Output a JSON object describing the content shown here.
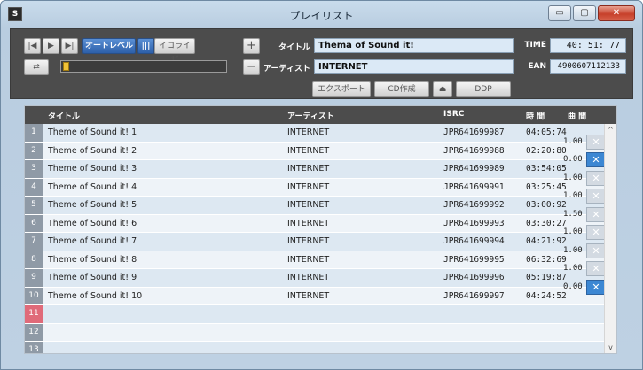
{
  "window": {
    "title": "プレイリスト",
    "minimize": "▭",
    "maximize": "▢",
    "close": "✕"
  },
  "toolbar": {
    "prev": "|◀",
    "play": "▶",
    "next": "▶|",
    "auto_level": "オートレベル",
    "eq_icon": "|||",
    "equalizer": "イコライザ",
    "repeat": "⇄",
    "add": "+",
    "remove": "−",
    "export": "エクスポート",
    "cd_create": "CD作成",
    "eject": "⏏",
    "ddp": "DDP"
  },
  "meta": {
    "title_label": "タイトル",
    "title_value": "Thema of Sound it!",
    "artist_label": "アーティスト",
    "artist_value": "INTERNET",
    "time_label": "TIME",
    "time_value": "40: 51: 77",
    "ean_label": "EAN",
    "ean_value": "4900607112133"
  },
  "columns": [
    "タイトル",
    "アーティスト",
    "ISRC",
    "時 間",
    "曲 間"
  ],
  "rows": [
    {
      "num": "1",
      "title": "Theme of Sound it! 1",
      "artist": "INTERNET",
      "isrc": "JPR641699987",
      "time": "04:05:74"
    },
    {
      "num": "2",
      "title": "Theme of Sound it! 2",
      "artist": "INTERNET",
      "isrc": "JPR641699988",
      "time": "02:20:80"
    },
    {
      "num": "3",
      "title": "Theme of Sound it! 3",
      "artist": "INTERNET",
      "isrc": "JPR641699989",
      "time": "03:54:05"
    },
    {
      "num": "4",
      "title": "Theme of Sound it! 4",
      "artist": "INTERNET",
      "isrc": "JPR641699991",
      "time": "03:25:45"
    },
    {
      "num": "5",
      "title": "Theme of Sound it! 5",
      "artist": "INTERNET",
      "isrc": "JPR641699992",
      "time": "03:00:92"
    },
    {
      "num": "6",
      "title": "Theme of Sound it! 6",
      "artist": "INTERNET",
      "isrc": "JPR641699993",
      "time": "03:30:27"
    },
    {
      "num": "7",
      "title": "Theme of Sound it! 7",
      "artist": "INTERNET",
      "isrc": "JPR641699994",
      "time": "04:21:92"
    },
    {
      "num": "8",
      "title": "Theme of Sound it! 8",
      "artist": "INTERNET",
      "isrc": "JPR641699995",
      "time": "06:32:69"
    },
    {
      "num": "9",
      "title": "Theme of Sound it! 9",
      "artist": "INTERNET",
      "isrc": "JPR641699996",
      "time": "05:19:87"
    },
    {
      "num": "10",
      "title": "Theme of Sound it! 10",
      "artist": "INTERNET",
      "isrc": "JPR641699997",
      "time": "04:24:52"
    },
    {
      "num": "11",
      "title": "",
      "artist": "",
      "isrc": "",
      "time": ""
    },
    {
      "num": "12",
      "title": "",
      "artist": "",
      "isrc": "",
      "time": ""
    },
    {
      "num": "13",
      "title": "",
      "artist": "",
      "isrc": "",
      "time": ""
    }
  ],
  "gaps": [
    {
      "value": "1.00",
      "active": false
    },
    {
      "value": "0.00",
      "active": true
    },
    {
      "value": "1.00",
      "active": false
    },
    {
      "value": "1.00",
      "active": false
    },
    {
      "value": "1.50",
      "active": false
    },
    {
      "value": "1.00",
      "active": false
    },
    {
      "value": "1.00",
      "active": false
    },
    {
      "value": "1.00",
      "active": false
    },
    {
      "value": "0.00",
      "active": true
    }
  ],
  "gap_icon": "✕",
  "scroll": {
    "up": "^",
    "down": "v"
  },
  "playback_progress": 0.0
}
